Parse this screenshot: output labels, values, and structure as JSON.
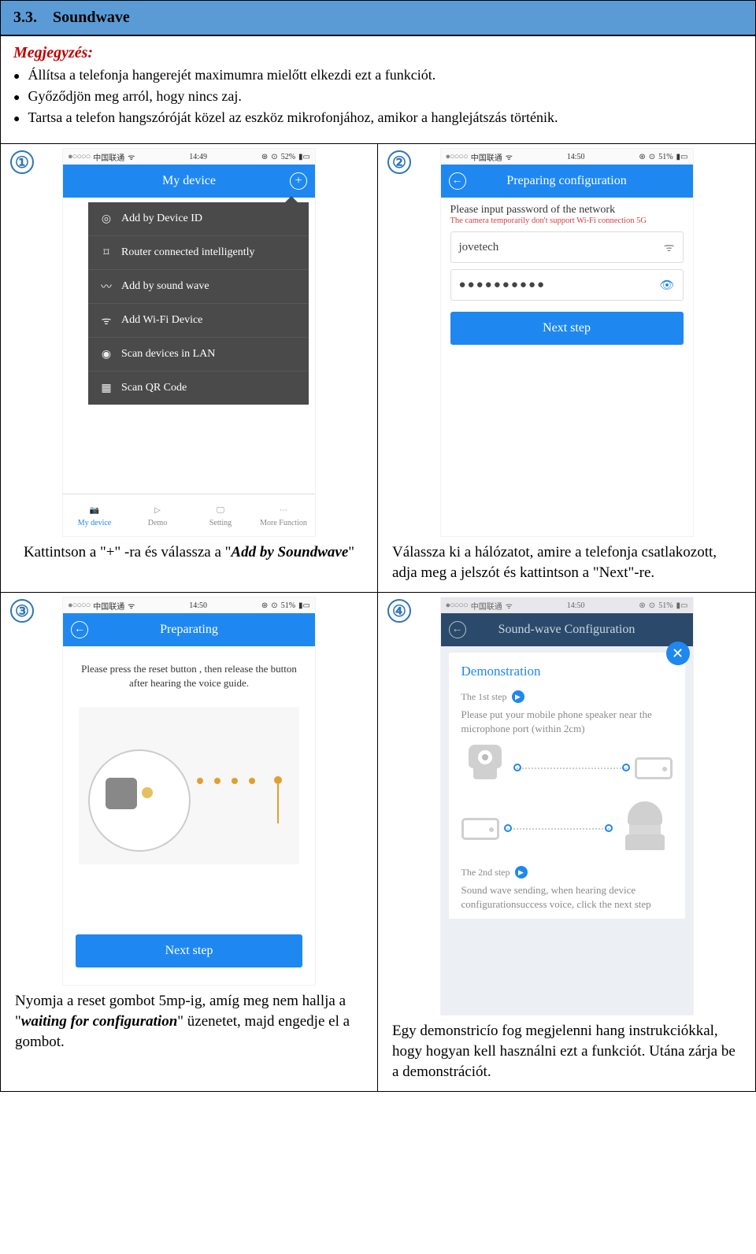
{
  "section": {
    "number": "3.3.",
    "title": "Soundwave"
  },
  "notes": {
    "title": "Megjegyzés:",
    "items": [
      "Állítsa a telefonja hangerejét maximumra mielőtt elkezdi ezt a funkciót.",
      "Győződjön meg arról, hogy nincs zaj.",
      "Tartsa a telefon hangszóróját közel az eszköz mikrofonjához, amikor a hanglejátszás történik."
    ]
  },
  "status": {
    "carrier": "中国联通",
    "t1": "14:49",
    "t2": "14:50",
    "t3": "14:50",
    "t4": "14:50",
    "b1": "52%",
    "b2": "51%",
    "b3": "51%",
    "b4": "51%"
  },
  "step1": {
    "num": "①",
    "nav_title": "My device",
    "menu": [
      "Add by Device ID",
      "Router connected intelligently",
      "Add by sound wave",
      "Add Wi-Fi Device",
      "Scan devices in LAN",
      "Scan QR Code"
    ],
    "tabs": [
      "My device",
      "Demo",
      "Setting",
      "More Function"
    ],
    "caption_a": "Kattintson a \"+\" -ra és válassza a \"",
    "caption_b": "Add by Soundwave",
    "caption_c": "\""
  },
  "step2": {
    "num": "②",
    "nav_title": "Preparing configuration",
    "prompt": "Please input password of the network",
    "warn": "The camera temporarily don't support Wi-Fi connection 5G",
    "ssid": "jovetech",
    "pw": "●●●●●●●●●●",
    "btn": "Next step",
    "caption": "Válassza ki a hálózatot, amire a telefonja csatlakozott, adja meg a jelszót és kattintson a \"Next\"-re."
  },
  "step3": {
    "num": "③",
    "nav_title": "Preparating",
    "msg": "Please press the reset button , then release the button after hearing the voice  guide.",
    "btn": "Next step",
    "caption_a": "Nyomja a reset gombot 5mp-ig, amíg meg nem hallja a \"",
    "caption_b": "waiting for configuration",
    "caption_c": "\" üzenetet, majd engedje el a gombot."
  },
  "step4": {
    "num": "④",
    "nav_title": "Sound-wave Configuration",
    "demo_title": "Demonstration",
    "s1_label": "The 1st step",
    "s1_text": "Please put your mobile phone speaker near the microphone port (within 2cm)",
    "s2_label": "The 2nd step",
    "s2_text": "Sound wave sending, when hearing device configurationsuccess voice, click the next step",
    "caption": "Egy demonstricío fog megjelenni hang instrukciókkal, hogy hogyan kell használni ezt a funkciót. Utána zárja be a demonstrációt."
  }
}
